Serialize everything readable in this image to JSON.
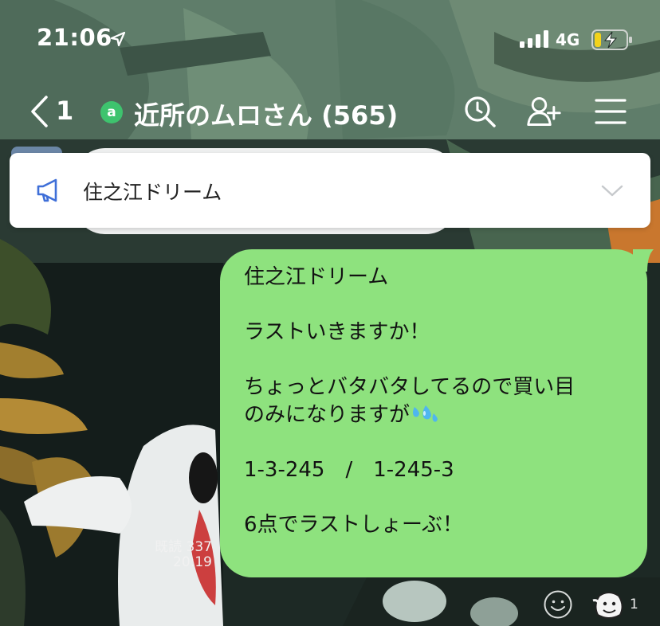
{
  "status_bar": {
    "time": "21:06",
    "network": "4G",
    "icons": [
      "location-arrow-icon",
      "signal-bars-icon",
      "battery-charging-icon"
    ]
  },
  "header": {
    "back_count": "1",
    "chat_badge": "a",
    "chat_title": "近所のムロさん (565)",
    "icons": [
      "back-chevron-icon",
      "search-icon",
      "add-friend-icon",
      "menu-icon"
    ]
  },
  "announcement": {
    "text": "住之江ドリーム",
    "icons": [
      "megaphone-icon",
      "chevron-down-icon"
    ]
  },
  "message": {
    "lines": [
      "住之江ドリーム",
      "",
      "ラストいきますか！",
      "",
      "ちょっとバタバタしてるので買い目",
      "のみになりますが",
      "",
      "1-3-245　/　1-245-3",
      "",
      "6点でラストしょーぶ！"
    ],
    "emoji": "sweat-drops-icon",
    "read_label": "既読 337",
    "time": "20:19",
    "bubble_color": "#8ee27e"
  },
  "reactions": {
    "count": "1",
    "icons": [
      "smiley-react-icon",
      "sticker-reaction-icon"
    ]
  }
}
